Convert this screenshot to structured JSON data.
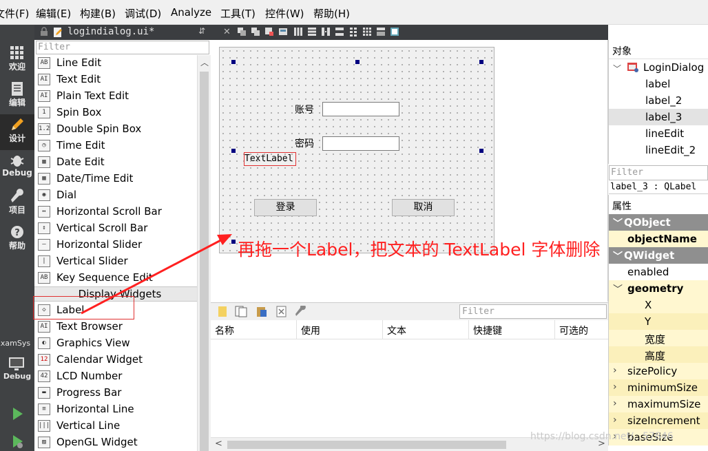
{
  "menubar": {
    "items": [
      "文件(F)",
      "编辑(E)",
      "构建(B)",
      "调试(D)",
      "Analyze",
      "工具(T)",
      "控件(W)",
      "帮助(H)"
    ]
  },
  "modebar": {
    "modes": [
      {
        "label": "欢迎",
        "icon": "grid-icon"
      },
      {
        "label": "编辑",
        "icon": "document-icon"
      },
      {
        "label": "设计",
        "icon": "pencil-icon"
      },
      {
        "label": "Debug",
        "icon": "bug-icon"
      },
      {
        "label": "项目",
        "icon": "wrench-icon"
      },
      {
        "label": "帮助",
        "icon": "help-icon"
      }
    ],
    "kit_label": "ExamSys",
    "build_label": "Debug",
    "run_label": "Run"
  },
  "widgetbox": {
    "file_name": "logindialog.ui*",
    "filter_placeholder": "Filter",
    "items": [
      {
        "label": "Line Edit",
        "icon": "AB"
      },
      {
        "label": "Text Edit",
        "icon": "AI"
      },
      {
        "label": "Plain Text Edit",
        "icon": "AI"
      },
      {
        "label": "Spin Box",
        "icon": "1"
      },
      {
        "label": "Double Spin Box",
        "icon": "1.2"
      },
      {
        "label": "Time Edit",
        "icon": "◷"
      },
      {
        "label": "Date Edit",
        "icon": "▦"
      },
      {
        "label": "Date/Time Edit",
        "icon": "▦"
      },
      {
        "label": "Dial",
        "icon": "◉"
      },
      {
        "label": "Horizontal Scroll Bar",
        "icon": "↔"
      },
      {
        "label": "Vertical Scroll Bar",
        "icon": "↕"
      },
      {
        "label": "Horizontal Slider",
        "icon": "—"
      },
      {
        "label": "Vertical Slider",
        "icon": "|"
      },
      {
        "label": "Key Sequence Edit",
        "icon": "AB"
      }
    ],
    "category": "Display Widgets",
    "display_items": [
      {
        "label": "Label",
        "icon": "◇"
      },
      {
        "label": "Text Browser",
        "icon": "AI"
      },
      {
        "label": "Graphics View",
        "icon": "◐"
      },
      {
        "label": "Calendar Widget",
        "icon": "12"
      },
      {
        "label": "LCD Number",
        "icon": "42"
      },
      {
        "label": "Progress Bar",
        "icon": "▬"
      },
      {
        "label": "Horizontal Line",
        "icon": "≡"
      },
      {
        "label": "Vertical Line",
        "icon": "|||"
      },
      {
        "label": "OpenGL Widget",
        "icon": "▨"
      }
    ]
  },
  "form": {
    "account_label": "账号",
    "password_label": "密码",
    "text_label": "TextLabel",
    "login_button": "登录",
    "cancel_button": "取消"
  },
  "annotation": {
    "text": "再拖一个Label，把文本的 TextLabel 字体删除"
  },
  "action_editor": {
    "filter_placeholder": "Filter",
    "columns": [
      "名称",
      "使用",
      "文本",
      "快捷键",
      "可选的"
    ]
  },
  "object_inspector": {
    "header": "对象",
    "root": "LoginDialog",
    "children": [
      "label",
      "label_2",
      "label_3",
      "lineEdit",
      "lineEdit_2"
    ],
    "selected_index": 2
  },
  "property_editor": {
    "filter_placeholder": "Filter",
    "class_line": "label_3 : QLabel",
    "header": "属性",
    "rows": [
      {
        "label": "QObject",
        "kind": "group"
      },
      {
        "label": "objectName",
        "kind": "bold"
      },
      {
        "label": "QWidget",
        "kind": "group"
      },
      {
        "label": "enabled",
        "kind": "plain"
      },
      {
        "label": "geometry",
        "kind": "expanded"
      },
      {
        "label": "X",
        "kind": "sub"
      },
      {
        "label": "Y",
        "kind": "sub"
      },
      {
        "label": "宽度",
        "kind": "sub"
      },
      {
        "label": "高度",
        "kind": "sub"
      },
      {
        "label": "sizePolicy",
        "kind": "collapsed"
      },
      {
        "label": "minimumSize",
        "kind": "collapsed"
      },
      {
        "label": "maximumSize",
        "kind": "collapsed"
      },
      {
        "label": "sizeIncrement",
        "kind": "collapsed"
      },
      {
        "label": "baseSize",
        "kind": "collapsed"
      }
    ]
  },
  "watermark": "https://blog.csdn.net/...57846",
  "colors": {
    "annotation": "#ff2020",
    "handle": "#000080",
    "group_row": "#8f8f8f",
    "modebar": "#404244"
  }
}
